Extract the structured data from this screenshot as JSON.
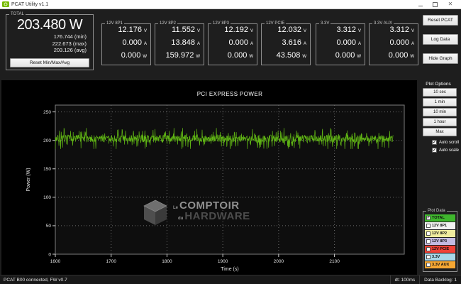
{
  "window": {
    "title": "PCAT Utility v1.1"
  },
  "total": {
    "label": "TOTAL",
    "value": "203.480 W",
    "stats": [
      "176.744 (min)",
      "222.673 (max)",
      "203.126 (avg)"
    ],
    "reset_button": "Reset Min/Max/Avg"
  },
  "units": [
    "V",
    "A",
    "W"
  ],
  "channels": [
    {
      "label": "12V 8P1",
      "values": [
        "12.176",
        "0.000",
        "0.000"
      ]
    },
    {
      "label": "12V 8P2",
      "values": [
        "11.552",
        "13.848",
        "159.972"
      ]
    },
    {
      "label": "12V 8P3",
      "values": [
        "12.192",
        "0.000",
        "0.000"
      ]
    },
    {
      "label": "12V PCIE",
      "values": [
        "12.032",
        "3.616",
        "43.508"
      ]
    },
    {
      "label": "3.3V",
      "values": [
        "3.312",
        "0.000",
        "0.000"
      ]
    },
    {
      "label": "3.3V AUX",
      "values": [
        "3.312",
        "0.000",
        "0.000"
      ]
    }
  ],
  "actions": [
    "Reset PCAT",
    "Log Data",
    "Hide Graph"
  ],
  "plot_options": {
    "label": "Plot Options",
    "buttons": [
      "10 sec",
      "1 min",
      "10 min",
      "1 hour",
      "Max"
    ],
    "auto_scroll": {
      "label": "Auto scroll",
      "checked": true
    },
    "auto_scale": {
      "label": "Auto scale",
      "checked": true
    }
  },
  "plot_data": {
    "label": "Plot Data",
    "items": [
      {
        "label": "TOTAL",
        "checked": true,
        "color": "#3fb72d"
      },
      {
        "label": "12V 8P1",
        "checked": false,
        "color": "#f2f2f2"
      },
      {
        "label": "12V 8P2",
        "checked": false,
        "color": "#efeb9e"
      },
      {
        "label": "12V 8P3",
        "checked": false,
        "color": "#c3bbe2"
      },
      {
        "label": "12V PCIE",
        "checked": false,
        "color": "#ef4136"
      },
      {
        "label": "3.3V",
        "checked": false,
        "color": "#a8d7e8"
      },
      {
        "label": "3.3V AUX",
        "checked": false,
        "color": "#f5a733"
      }
    ]
  },
  "watermark": {
    "prefix1": "Le",
    "word1": "COMPTOIR",
    "prefix2": "du",
    "word2": "HARDWARE"
  },
  "status_bar": {
    "device": "PCAT B00 connected, FW v0.7",
    "dt": "dt: 100ms",
    "backlog": "Data Backlog: 1"
  },
  "chart_data": {
    "type": "line",
    "title": "PCI EXPRESS POWER",
    "xlabel": "Time (s)",
    "ylabel": "Power (W)",
    "xlim": [
      1600,
      2225
    ],
    "ylim": [
      0,
      262
    ],
    "x_ticks": [
      1600,
      1700,
      1800,
      1900,
      2000,
      2100
    ],
    "y_ticks": [
      0,
      50,
      100,
      150,
      200,
      250
    ],
    "grid": "dotted",
    "legend": "none",
    "series": [
      {
        "name": "TOTAL",
        "color": "#5fb414",
        "x_start": 1600,
        "x_end": 2205,
        "mean_w": 203.1,
        "band_low_w": 190,
        "band_high_w": 216,
        "min_w": 176.744,
        "max_w": 222.673,
        "description": "dense high-frequency noise band around mean total power",
        "seed": 7,
        "points_per_second": 2
      }
    ]
  }
}
